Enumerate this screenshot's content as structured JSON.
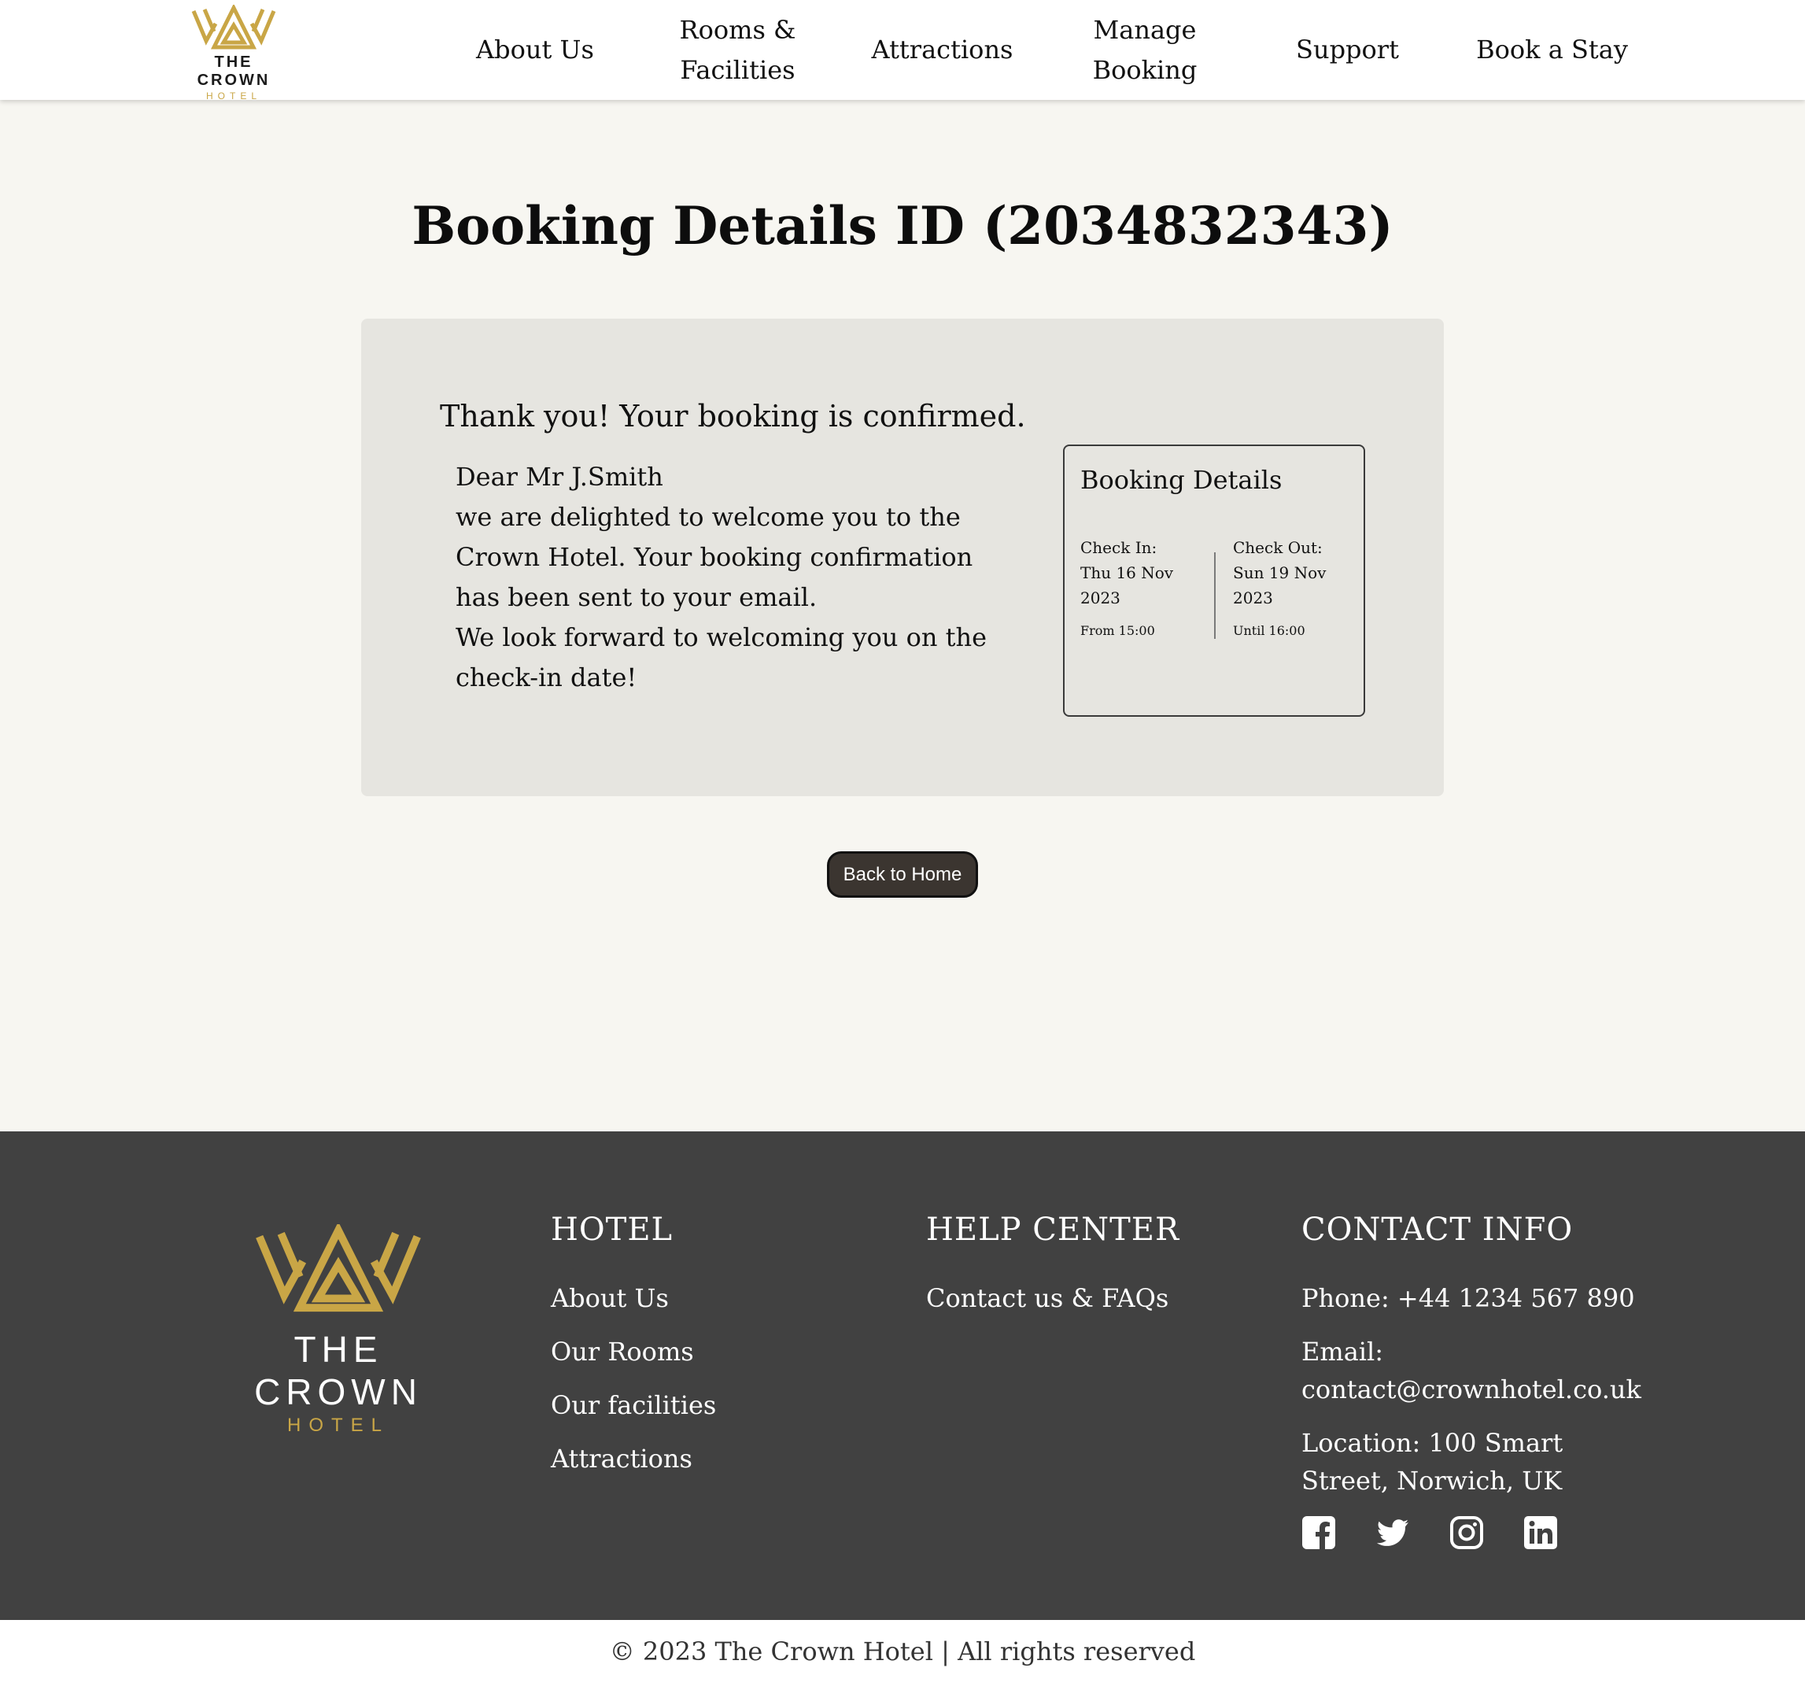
{
  "header": {
    "logo": {
      "name": "THE CROWN",
      "sub": "HOTEL"
    },
    "nav": [
      {
        "label": "About Us"
      },
      {
        "label": "Rooms &\nFacilities"
      },
      {
        "label": "Attractions"
      },
      {
        "label": "Manage\nBooking"
      },
      {
        "label": "Support"
      },
      {
        "label": "Book a Stay"
      }
    ]
  },
  "main": {
    "title": "Booking Details ID (2034832343)",
    "confirm_heading": "Thank you! Your booking is confirmed.",
    "message": {
      "greeting": "Dear Mr J.Smith",
      "line1": "we are delighted to welcome you to the Crown Hotel. Your booking confirmation has been sent to your email.",
      "line2": "We look forward to welcoming you on the check-in date!"
    },
    "details": {
      "title": "Booking Details",
      "check_in": {
        "label": "Check In:",
        "date": "Thu 16 Nov 2023",
        "time": "From 15:00"
      },
      "check_out": {
        "label": "Check Out:",
        "date": "Sun 19 Nov 2023",
        "time": "Until 16:00"
      }
    },
    "back_button": "Back to Home"
  },
  "footer": {
    "logo": {
      "name": "THE CROWN",
      "sub": "HOTEL"
    },
    "hotel": {
      "heading": "HOTEL",
      "links": [
        "About Us",
        "Our Rooms",
        "Our facilities",
        "Attractions"
      ]
    },
    "help": {
      "heading": "HELP CENTER",
      "links": [
        "Contact us & FAQs"
      ]
    },
    "contact": {
      "heading": "CONTACT INFO",
      "phone": "Phone: +44 1234 567 890",
      "email_label": "Email:",
      "email": "contact@crownhotel.co.uk",
      "location": "Location: 100 Smart Street, Norwich, UK"
    },
    "socials": [
      "facebook-icon",
      "twitter-icon",
      "instagram-icon",
      "linkedin-icon"
    ],
    "copyright": "© 2023 The Crown Hotel | All rights reserved"
  },
  "colors": {
    "gold": "#c9a646",
    "footer_bg": "#414141",
    "page_bg": "#f7f6f1",
    "card_bg": "#e6e5e0",
    "button_bg": "#3b3530"
  }
}
